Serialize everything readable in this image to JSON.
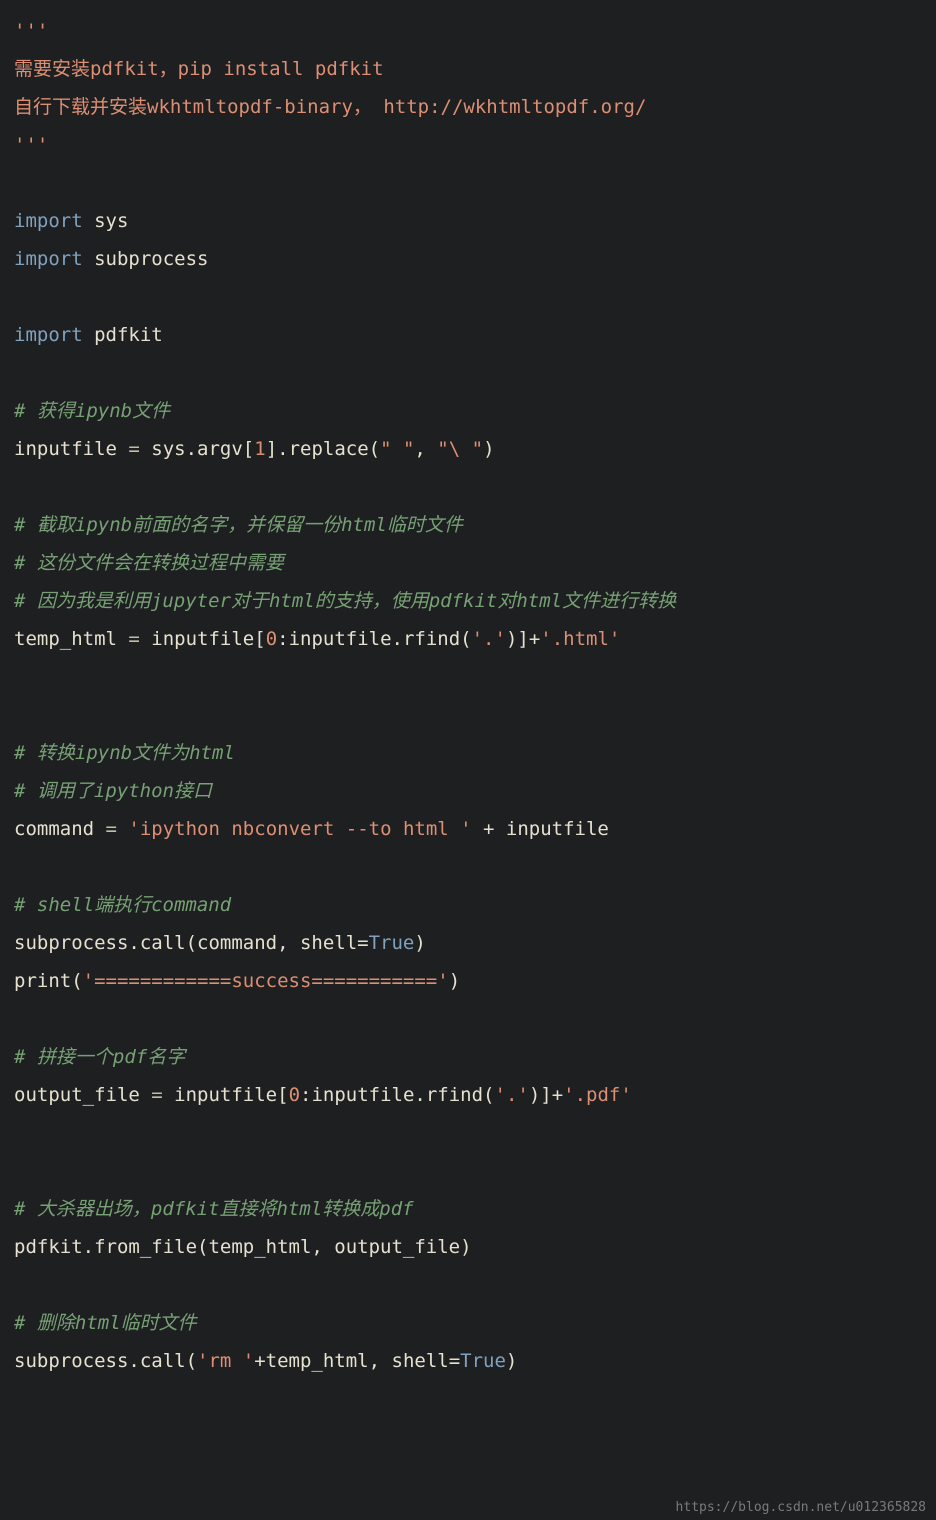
{
  "code": {
    "lines": [
      [
        {
          "cls": "string",
          "t": "'''"
        }
      ],
      [
        {
          "cls": "string-cjk",
          "t": "需要安装pdfkit，pip install pdfkit"
        }
      ],
      [
        {
          "cls": "string-cjk",
          "t": "自行下载并安装wkhtmltopdf-binary， http://wkhtmltopdf.org/"
        }
      ],
      [
        {
          "cls": "string",
          "t": "'''"
        }
      ],
      [
        {
          "cls": "",
          "t": ""
        }
      ],
      [
        {
          "cls": "keyword",
          "t": "import"
        },
        {
          "cls": "ident",
          "t": " sys"
        }
      ],
      [
        {
          "cls": "keyword",
          "t": "import"
        },
        {
          "cls": "ident",
          "t": " subprocess"
        }
      ],
      [
        {
          "cls": "",
          "t": ""
        }
      ],
      [
        {
          "cls": "keyword",
          "t": "import"
        },
        {
          "cls": "ident",
          "t": " pdfkit"
        }
      ],
      [
        {
          "cls": "",
          "t": ""
        }
      ],
      [
        {
          "cls": "comment",
          "t": "# 获得ipynb文件"
        }
      ],
      [
        {
          "cls": "ident",
          "t": "inputfile "
        },
        {
          "cls": "op",
          "t": "="
        },
        {
          "cls": "ident",
          "t": " sys.argv["
        },
        {
          "cls": "string",
          "t": "1"
        },
        {
          "cls": "ident",
          "t": "].replace("
        },
        {
          "cls": "string",
          "t": "\" \""
        },
        {
          "cls": "ident",
          "t": ", "
        },
        {
          "cls": "string",
          "t": "\"\\ \""
        },
        {
          "cls": "ident",
          "t": ")"
        }
      ],
      [
        {
          "cls": "",
          "t": ""
        }
      ],
      [
        {
          "cls": "comment",
          "t": "# 截取ipynb前面的名字，并保留一份html临时文件"
        }
      ],
      [
        {
          "cls": "comment",
          "t": "# 这份文件会在转换过程中需要"
        }
      ],
      [
        {
          "cls": "comment",
          "t": "# 因为我是利用jupyter对于html的支持，使用pdfkit对html文件进行转换"
        }
      ],
      [
        {
          "cls": "ident",
          "t": "temp_html "
        },
        {
          "cls": "op",
          "t": "="
        },
        {
          "cls": "ident",
          "t": " inputfile["
        },
        {
          "cls": "string",
          "t": "0"
        },
        {
          "cls": "ident",
          "t": ":inputfile.rfind("
        },
        {
          "cls": "string",
          "t": "'.'"
        },
        {
          "cls": "ident",
          "t": ")]+"
        },
        {
          "cls": "string",
          "t": "'.html'"
        }
      ],
      [
        {
          "cls": "",
          "t": ""
        }
      ],
      [
        {
          "cls": "",
          "t": ""
        }
      ],
      [
        {
          "cls": "comment",
          "t": "# 转换ipynb文件为html"
        }
      ],
      [
        {
          "cls": "comment",
          "t": "# 调用了ipython接口"
        }
      ],
      [
        {
          "cls": "ident",
          "t": "command "
        },
        {
          "cls": "op",
          "t": "="
        },
        {
          "cls": "ident",
          "t": " "
        },
        {
          "cls": "string",
          "t": "'ipython nbconvert --to html '"
        },
        {
          "cls": "ident",
          "t": " + inputfile"
        }
      ],
      [
        {
          "cls": "",
          "t": ""
        }
      ],
      [
        {
          "cls": "comment",
          "t": "# shell端执行command"
        }
      ],
      [
        {
          "cls": "ident",
          "t": "subprocess.call(command, shell="
        },
        {
          "cls": "builtin",
          "t": "True"
        },
        {
          "cls": "ident",
          "t": ")"
        }
      ],
      [
        {
          "cls": "ident",
          "t": "print("
        },
        {
          "cls": "string",
          "t": "'============success==========='"
        },
        {
          "cls": "ident",
          "t": ")"
        }
      ],
      [
        {
          "cls": "",
          "t": ""
        }
      ],
      [
        {
          "cls": "comment",
          "t": "# 拼接一个pdf名字"
        }
      ],
      [
        {
          "cls": "ident",
          "t": "output_file "
        },
        {
          "cls": "op",
          "t": "="
        },
        {
          "cls": "ident",
          "t": " inputfile["
        },
        {
          "cls": "string",
          "t": "0"
        },
        {
          "cls": "ident",
          "t": ":inputfile.rfind("
        },
        {
          "cls": "string",
          "t": "'.'"
        },
        {
          "cls": "ident",
          "t": ")]+"
        },
        {
          "cls": "string",
          "t": "'.pdf'"
        }
      ],
      [
        {
          "cls": "",
          "t": ""
        }
      ],
      [
        {
          "cls": "",
          "t": ""
        }
      ],
      [
        {
          "cls": "comment",
          "t": "# 大杀器出场，pdfkit直接将html转换成pdf"
        }
      ],
      [
        {
          "cls": "ident",
          "t": "pdfkit.from_file(temp_html, output_file)"
        }
      ],
      [
        {
          "cls": "",
          "t": ""
        }
      ],
      [
        {
          "cls": "comment",
          "t": "# 删除html临时文件"
        }
      ],
      [
        {
          "cls": "ident",
          "t": "subprocess.call("
        },
        {
          "cls": "string",
          "t": "'rm '"
        },
        {
          "cls": "ident",
          "t": "+temp_html, shell="
        },
        {
          "cls": "builtin",
          "t": "True"
        },
        {
          "cls": "ident",
          "t": ")"
        }
      ]
    ]
  },
  "watermark": "https://blog.csdn.net/u012365828"
}
